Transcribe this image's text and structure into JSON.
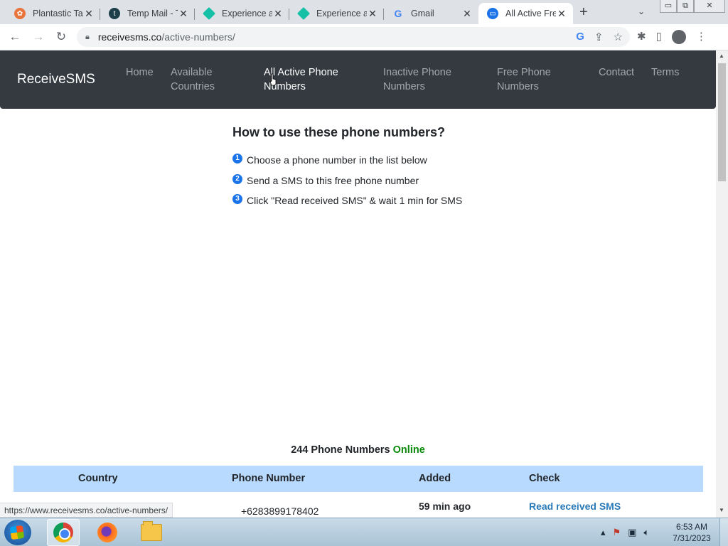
{
  "browser": {
    "tabs": [
      {
        "title": "Plantastic Ta",
        "favicon": "plant-icon",
        "color": "#e8743b",
        "active": false
      },
      {
        "title": "Temp Mail - T",
        "favicon": "tempmail-icon",
        "color": "#1c3f4a",
        "active": false
      },
      {
        "title": "Experience a",
        "favicon": "diamond-icon",
        "color": "#15c1a6",
        "active": false
      },
      {
        "title": "Experience a",
        "favicon": "diamond-icon",
        "color": "#15c1a6",
        "active": false
      },
      {
        "title": "Gmail",
        "favicon": "google-icon",
        "color": "#4285f4",
        "active": false
      },
      {
        "title": "All Active Fre",
        "favicon": "chat-icon",
        "color": "#1a73e8",
        "active": true
      }
    ],
    "new_tab": "+",
    "tab_search": "⌄",
    "window_controls": {
      "minimize": "▭",
      "restore": "⧉",
      "close": "✕"
    },
    "url_host": "receivesms.co",
    "url_path": "/active-numbers/",
    "status_url": "https://www.receivesms.co/active-numbers/"
  },
  "site": {
    "brand": "ReceiveSMS",
    "nav": [
      {
        "line1": "Home",
        "line2": ""
      },
      {
        "line1": "Available",
        "line2": "Countries"
      },
      {
        "line1": "All Active Phone",
        "line2": "Numbers"
      },
      {
        "line1": "Inactive Phone",
        "line2": "Numbers"
      },
      {
        "line1": "Free Phone",
        "line2": "Numbers"
      },
      {
        "line1": "Contact",
        "line2": ""
      },
      {
        "line1": "Terms",
        "line2": ""
      }
    ],
    "active_nav": "All Active Phone Numbers",
    "howto": {
      "title": "How to use these phone numbers?",
      "steps": [
        {
          "num": "1",
          "text": "Choose a phone number in the list below"
        },
        {
          "num": "2",
          "text": "Send a SMS to this free phone number"
        },
        {
          "num": "3",
          "text": "Click \"Read received SMS\" & wait 1 min for SMS"
        }
      ]
    },
    "online": {
      "count_text": "244 Phone Numbers",
      "status": "Online"
    },
    "table": {
      "headers": [
        "Country",
        "Phone Number",
        "Added",
        "Check"
      ],
      "rows": [
        {
          "country": "",
          "phone": "+6283899178402",
          "added": "59 min ago",
          "check": "Read received SMS"
        }
      ]
    }
  },
  "taskbar": {
    "apps": [
      "start-button",
      "chrome",
      "firefox",
      "file-explorer"
    ],
    "clock_time": "6:53 AM",
    "clock_date": "7/31/2023"
  },
  "colors": {
    "navbar": "#343a40",
    "table_header": "#b8daff",
    "online_green": "#0a8a0a",
    "link_blue": "#2a7ab8"
  }
}
